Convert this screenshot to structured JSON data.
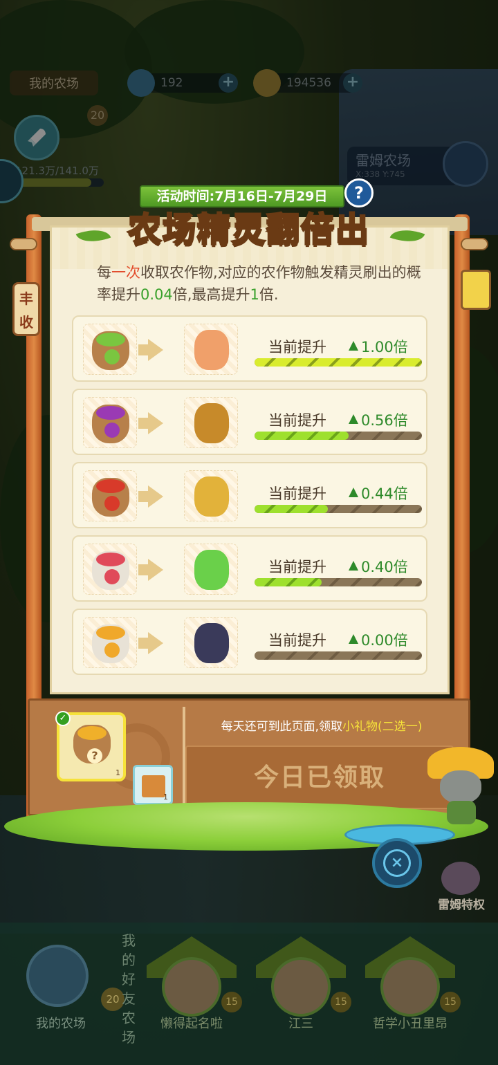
{
  "hud": {
    "farm_tag": "我的农场",
    "gems": "192",
    "coins": "194536",
    "level": "20",
    "stat": "121.3万/141.0万",
    "stat_progress": 0.86,
    "remote_farm_name": "雷姆农场",
    "remote_farm_coord": "X:338 Y:745"
  },
  "panel": {
    "date_banner": "活动时间:7月16日-7月29日",
    "help_label": "?",
    "title": "农场精灵翻倍出",
    "side_tag": "丰收",
    "desc_part1": "每",
    "desc_hl1": "一次",
    "desc_part2": "收取农作物,对应的农作物触发精灵刷出的概率提升",
    "desc_hl2": "0.04",
    "desc_part3": "倍,最高提升",
    "desc_hl3": "1",
    "desc_part4": "倍.",
    "rows": [
      {
        "label": "当前提升",
        "value": "1.00倍",
        "progress": 1.0,
        "crop_color": "#7ac640",
        "sack": "brown",
        "creature_color": "#f0a06a"
      },
      {
        "label": "当前提升",
        "value": "0.56倍",
        "progress": 0.56,
        "crop_color": "#9a3ab4",
        "sack": "brown",
        "creature_color": "#c78a2a"
      },
      {
        "label": "当前提升",
        "value": "0.44倍",
        "progress": 0.44,
        "crop_color": "#d83a2a",
        "sack": "brown",
        "creature_color": "#e2b23a"
      },
      {
        "label": "当前提升",
        "value": "0.40倍",
        "progress": 0.4,
        "crop_color": "#e04a5a",
        "sack": "white",
        "creature_color": "#6ad04a"
      },
      {
        "label": "当前提升",
        "value": "0.00倍",
        "progress": 0.0,
        "crop_color": "#f0a82a",
        "sack": "white",
        "creature_color": "#3a3a5a"
      }
    ]
  },
  "reward": {
    "info_text_part1": "每天还可到此页面,领取",
    "info_text_hl": "小礼物(二选一)",
    "claim_label": "今日已领取",
    "gift_qmark": "?",
    "gift_count": "1",
    "alt_count": "1",
    "check": "✓"
  },
  "close_label": "×",
  "rem_privilege": "雷姆特权",
  "friend_bar": {
    "my_farm_label": "我的农场",
    "my_level": "20",
    "friends_title": "我的好友农场",
    "friends": [
      {
        "name": "懒得起名啦",
        "level": "15"
      },
      {
        "name": "江三",
        "level": "15"
      },
      {
        "name": "哲学小丑里昂",
        "level": "15"
      }
    ]
  }
}
